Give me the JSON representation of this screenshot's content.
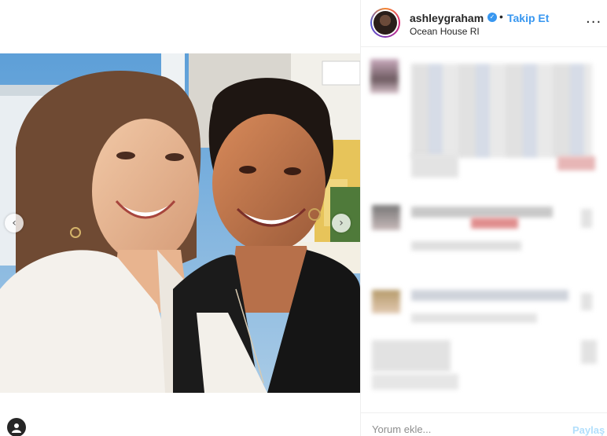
{
  "post": {
    "username": "ashleygraham",
    "verified": true,
    "separator": "•",
    "follow_label": "Takip Et",
    "location": "Ocean House RI"
  },
  "icons": {
    "verified": "verified-badge-icon",
    "more": "more-options-icon",
    "prev": "chevron-left-icon",
    "next": "chevron-right-icon",
    "tag": "user-tag-icon"
  },
  "comment_box": {
    "placeholder": "Yorum ekle...",
    "share_label": "Paylaş"
  },
  "colors": {
    "link_blue": "#3897f0",
    "share_disabled": "#b2dffc",
    "border": "#efefef"
  }
}
